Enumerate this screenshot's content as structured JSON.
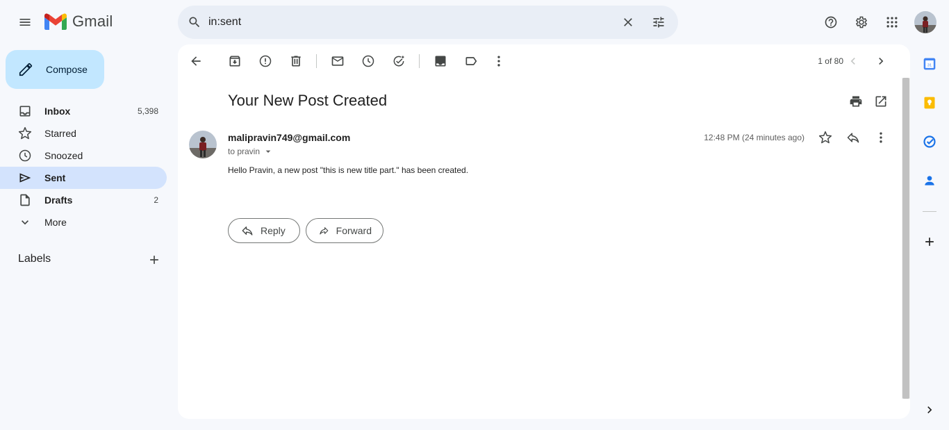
{
  "app": {
    "name": "Gmail"
  },
  "search": {
    "value": "in:sent"
  },
  "compose": {
    "label": "Compose"
  },
  "nav": {
    "items": [
      {
        "label": "Inbox",
        "count": "5,398"
      },
      {
        "label": "Starred",
        "count": ""
      },
      {
        "label": "Snoozed",
        "count": ""
      },
      {
        "label": "Sent",
        "count": ""
      },
      {
        "label": "Drafts",
        "count": "2"
      },
      {
        "label": "More",
        "count": ""
      }
    ],
    "labels_heading": "Labels"
  },
  "toolbar": {
    "pager": "1 of 80"
  },
  "email": {
    "subject": "Your New Post Created",
    "sender": "malipravin749@gmail.com",
    "to": "to pravin",
    "time": "12:48 PM (24 minutes ago)",
    "body": "Hello Pravin, a new post \"this is new title part.\" has been created.",
    "reply_label": "Reply",
    "forward_label": "Forward"
  },
  "colors": {
    "background": "#f6f8fc",
    "compose": "#c2e7ff",
    "active_nav": "#d3e3fd",
    "search": "#e9eef6"
  },
  "icons": {
    "top": [
      "menu-icon",
      "gmail-logo",
      "search-icon",
      "close-icon",
      "tune-icon",
      "help-icon",
      "settings-icon",
      "apps-icon"
    ],
    "toolbar": [
      "back-arrow-icon",
      "archive-icon",
      "report-spam-icon",
      "delete-icon",
      "mark-unread-icon",
      "snooze-icon",
      "add-task-icon",
      "move-to-icon",
      "label-icon",
      "more-vert-icon",
      "chevron-left-icon",
      "chevron-right-icon",
      "print-icon",
      "open-new-window-icon"
    ],
    "rail": [
      "calendar-icon",
      "keep-icon",
      "tasks-icon",
      "contacts-icon",
      "plus-icon",
      "chevron-right-icon"
    ]
  }
}
